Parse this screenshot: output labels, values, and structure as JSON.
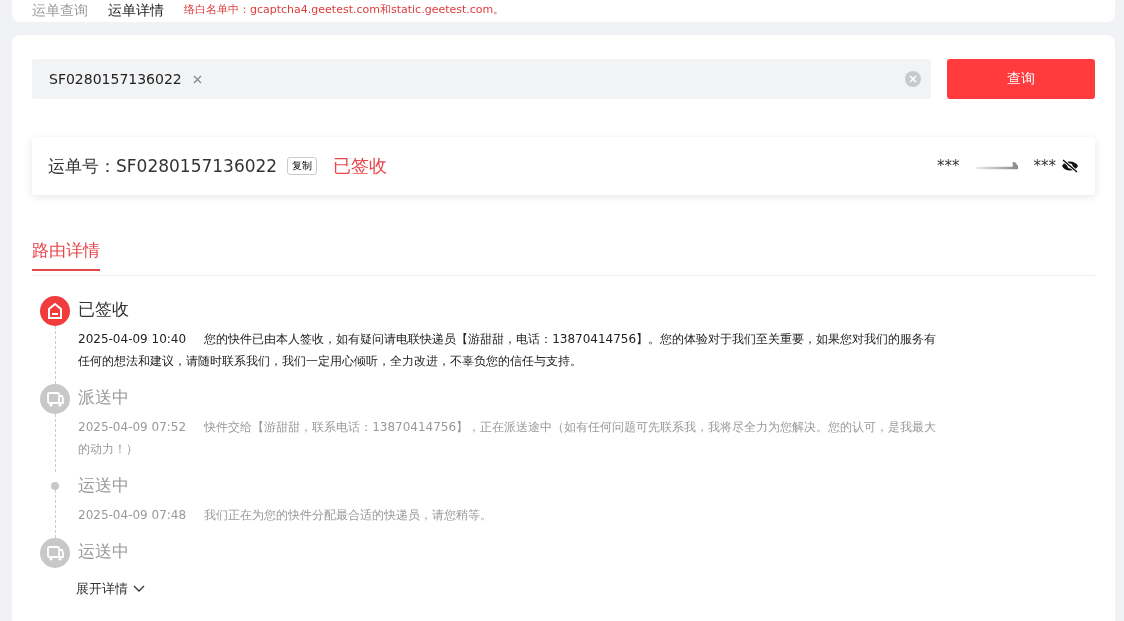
{
  "top_tabs": [
    {
      "label": "运单查询",
      "selected": false
    },
    {
      "label": "运单详情",
      "selected": true
    }
  ],
  "notice": "络白名单中：gcaptcha4.geetest.com和static.geetest.com。",
  "search": {
    "value": "SF0280157136022",
    "button": "查询"
  },
  "waybill": {
    "label": "运单号：SF0280157136022",
    "copy": "复制",
    "status": "已签收",
    "from": "***",
    "to": "***"
  },
  "section_tab": {
    "label": "路由详情",
    "selected": true
  },
  "timeline": [
    {
      "kind": "signed",
      "active": true,
      "title": "已签收",
      "time": "2025-04-09 10:40",
      "text": "您的快件已由本人签收，如有疑问请电联快递员【游甜甜，电话：13870414756】。您的体验对于我们至关重要，如果您对我们的服务有任何的想法和建议，请随时联系我们，我们一定用心倾听，全力改进，不辜负您的信任与支持。"
    },
    {
      "kind": "delivering",
      "active": false,
      "title": "派送中",
      "time": "2025-04-09 07:52",
      "text": "快件交给【游甜甜，联系电话：13870414756】，正在派送途中（如有任何问题可先联系我，我将尽全力为您解决。您的认可，是我最大的动力！）"
    },
    {
      "kind": "dot",
      "active": false,
      "title": "运送中",
      "time": "2025-04-09 07:48",
      "text": "我们正在为您的快件分配最合适的快递员，请您稍等。"
    },
    {
      "kind": "delivering",
      "active": false,
      "title": "运送中"
    }
  ],
  "expand": "展开详情"
}
